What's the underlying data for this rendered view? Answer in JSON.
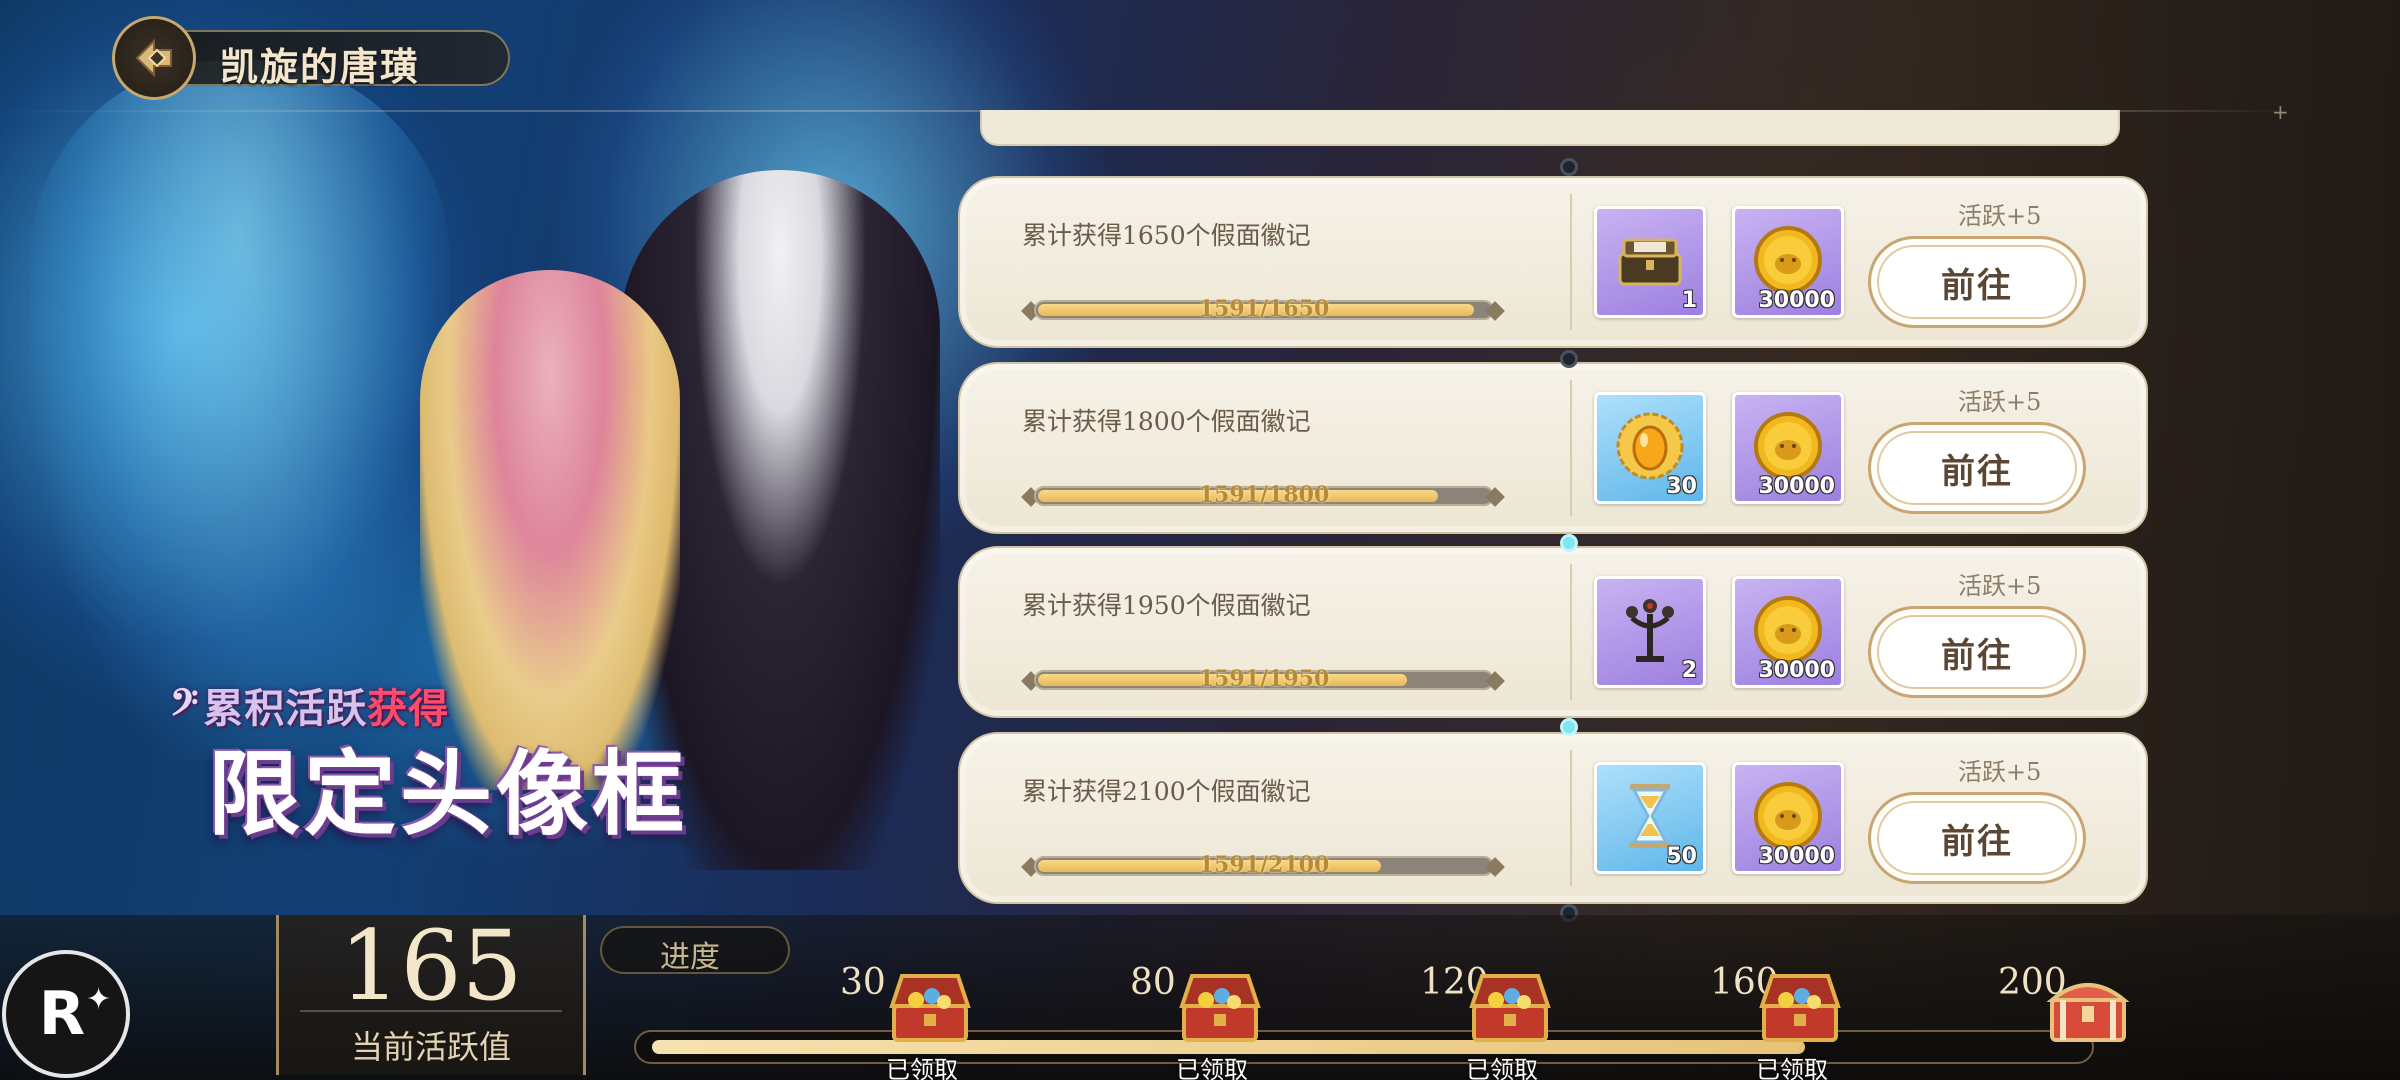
{
  "header": {
    "title": "凯旋的唐璜"
  },
  "promo": {
    "line1_prefix": "累积活跃",
    "line1_accent": "获得",
    "line2": "限定头像框",
    "clef_glyph": "𝄢"
  },
  "tasks": [
    {
      "description": "累计获得1650个假面徽记",
      "progress_text": "1591/1650",
      "progress_fraction": 0.964,
      "active_label": "活跃+5",
      "button_label": "前往",
      "rewards": [
        {
          "icon": "treasure-box-icon",
          "qty": "1",
          "rarity": "purple"
        },
        {
          "icon": "gold-coin-icon",
          "qty": "30000",
          "rarity": "purple"
        }
      ]
    },
    {
      "description": "累计获得1800个假面徽记",
      "progress_text": "1591/1800",
      "progress_fraction": 0.884,
      "active_label": "活跃+5",
      "button_label": "前往",
      "rewards": [
        {
          "icon": "golden-sun-egg-icon",
          "qty": "30",
          "rarity": "blue"
        },
        {
          "icon": "gold-coin-icon",
          "qty": "30000",
          "rarity": "purple"
        }
      ]
    },
    {
      "description": "累计获得1950个假面徽记",
      "progress_text": "1591/1950",
      "progress_fraction": 0.816,
      "active_label": "活跃+5",
      "button_label": "前往",
      "rewards": [
        {
          "icon": "candelabra-icon",
          "qty": "2",
          "rarity": "purple"
        },
        {
          "icon": "gold-coin-icon",
          "qty": "30000",
          "rarity": "purple"
        }
      ]
    },
    {
      "description": "累计获得2100个假面徽记",
      "progress_text": "1591/2100",
      "progress_fraction": 0.758,
      "active_label": "活跃+5",
      "button_label": "前往",
      "rewards": [
        {
          "icon": "hourglass-icon",
          "qty": "50",
          "rarity": "blue"
        },
        {
          "icon": "gold-coin-icon",
          "qty": "30000",
          "rarity": "purple"
        }
      ]
    }
  ],
  "activity": {
    "current_value": "165",
    "current_label": "当前活跃值",
    "progress_label": "进度",
    "progress_fraction": 0.81,
    "milestones": [
      {
        "value": "30",
        "status": "已领取",
        "chest": "open-chest-icon"
      },
      {
        "value": "80",
        "status": "已领取",
        "chest": "open-chest-icon"
      },
      {
        "value": "120",
        "status": "已领取",
        "chest": "open-chest-icon"
      },
      {
        "value": "160",
        "status": "已领取",
        "chest": "open-chest-icon"
      },
      {
        "value": "200",
        "status": "",
        "chest": "closed-chest-icon"
      }
    ]
  },
  "colors": {
    "panel_bg": "#f6f2e8",
    "progress_fill": "#e7b955",
    "button_border": "#c9a574",
    "accent_red": "#ff4a6a"
  }
}
